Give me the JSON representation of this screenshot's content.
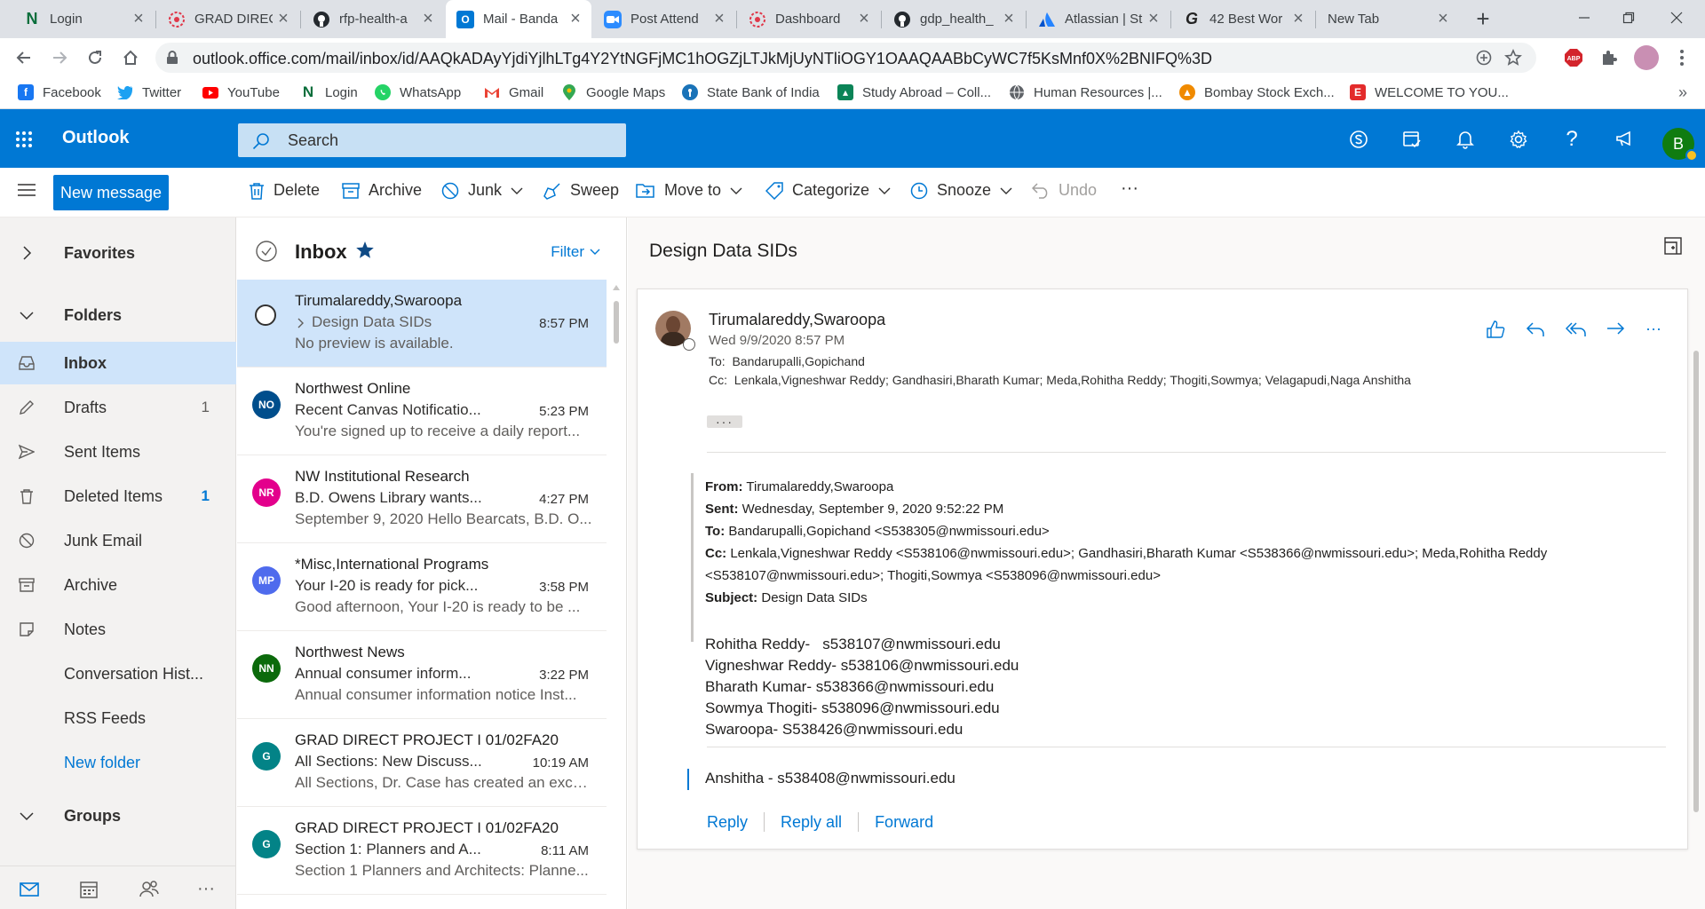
{
  "browser": {
    "tabs": [
      {
        "title": "Login",
        "favicon": "N",
        "color": "#0a6e3b"
      },
      {
        "title": "GRAD DIREC",
        "favicon": "canvas",
        "color": "#e0384a"
      },
      {
        "title": "rfp-health-a",
        "favicon": "github",
        "color": "#24292e"
      },
      {
        "title": "Mail - Banda",
        "favicon": "outlook",
        "color": "#0078d4"
      },
      {
        "title": "Post Attend",
        "favicon": "zoom",
        "color": "#2d8cff"
      },
      {
        "title": "Dashboard",
        "favicon": "canvas",
        "color": "#e0384a"
      },
      {
        "title": "gdp_health_",
        "favicon": "github",
        "color": "#24292e"
      },
      {
        "title": "Atlassian | St",
        "favicon": "atlassian",
        "color": "#0052cc"
      },
      {
        "title": "42 Best Wor",
        "favicon": "G",
        "color": "#222222"
      },
      {
        "title": "New Tab",
        "favicon": "",
        "color": ""
      }
    ],
    "url": "outlook.office.com/mail/inbox/id/AAQkADAyYjdiYjlhLTg4Y2YtNGFjMC1hOGZjLTJkMjUyNTliOGY1OAAQAABbCyWC7f5KsMnf0X%2BNIFQ%3D",
    "bookmarks": [
      {
        "label": "Facebook",
        "icon": "facebook-icon",
        "color": "#1877f2"
      },
      {
        "label": "Twitter",
        "icon": "twitter-icon",
        "color": "#1da1f2"
      },
      {
        "label": "YouTube",
        "icon": "youtube-icon",
        "color": "#ff0000"
      },
      {
        "label": "Login",
        "icon": "n-icon",
        "color": "#0a6e3b"
      },
      {
        "label": "WhatsApp",
        "icon": "whatsapp-icon",
        "color": "#25d366"
      },
      {
        "label": "Gmail",
        "icon": "gmail-icon",
        "color": "#ea4335"
      },
      {
        "label": "Google Maps",
        "icon": "maps-icon",
        "color": "#34a853"
      },
      {
        "label": "State Bank of India",
        "icon": "sbi-icon",
        "color": "#1a73b8"
      },
      {
        "label": "Study Abroad – Coll...",
        "icon": "study-icon",
        "color": "#0b8457"
      },
      {
        "label": "Human Resources |...",
        "icon": "globe-icon",
        "color": "#5f6368"
      },
      {
        "label": "Bombay Stock Exch...",
        "icon": "bse-icon",
        "color": "#f08a00"
      },
      {
        "label": "WELCOME TO YOU...",
        "icon": "e-icon",
        "color": "#e32b2b"
      }
    ],
    "abp_label": "ABP"
  },
  "outlook": {
    "brand": "Outlook",
    "search_placeholder": "Search",
    "user_initial": "B",
    "accent": "#0078d4"
  },
  "toolbar": {
    "new_message": "New message",
    "delete": "Delete",
    "archive": "Archive",
    "junk": "Junk",
    "sweep": "Sweep",
    "move_to": "Move to",
    "categorize": "Categorize",
    "snooze": "Snooze",
    "undo": "Undo",
    "more": "···"
  },
  "nav": {
    "favorites": "Favorites",
    "folders": "Folders",
    "items": [
      {
        "label": "Inbox",
        "count": ""
      },
      {
        "label": "Drafts",
        "count": "1"
      },
      {
        "label": "Sent Items",
        "count": ""
      },
      {
        "label": "Deleted Items",
        "count": "1"
      },
      {
        "label": "Junk Email",
        "count": ""
      },
      {
        "label": "Archive",
        "count": ""
      },
      {
        "label": "Notes",
        "count": ""
      },
      {
        "label": "Conversation Hist...",
        "count": ""
      },
      {
        "label": "RSS Feeds",
        "count": ""
      }
    ],
    "new_folder": "New folder",
    "groups": "Groups"
  },
  "list": {
    "title": "Inbox",
    "filter": "Filter",
    "messages": [
      {
        "sender": "Tirumalareddy,Swaroopa",
        "subject": "Design Data SIDs",
        "time": "8:57 PM",
        "preview": "No preview is available.",
        "initials": "",
        "color": ""
      },
      {
        "sender": "Northwest Online",
        "subject": "Recent Canvas Notificatio...",
        "time": "5:23 PM",
        "preview": "You're signed up to receive a daily report...",
        "initials": "NO",
        "color": "#004e8c"
      },
      {
        "sender": "NW Institutional Research",
        "subject": "B.D. Owens Library wants...",
        "time": "4:27 PM",
        "preview": "September 9, 2020 Hello Bearcats, B.D. O...",
        "initials": "NR",
        "color": "#e3008c"
      },
      {
        "sender": "*Misc,International Programs",
        "subject": "Your I-20 is ready for pick...",
        "time": "3:58 PM",
        "preview": "Good afternoon, Your I-20 is ready to be ...",
        "initials": "MP",
        "color": "#4f6bed"
      },
      {
        "sender": "Northwest News",
        "subject": "Annual consumer inform...",
        "time": "3:22 PM",
        "preview": "Annual consumer information notice Inst...",
        "initials": "NN",
        "color": "#0b6a0b"
      },
      {
        "sender": "GRAD DIRECT PROJECT I 01/02FA20",
        "subject": "All Sections: New Discuss...",
        "time": "10:19 AM",
        "preview": "All Sections, Dr. Case has created an exce...",
        "initials": "G",
        "color": "#038387"
      },
      {
        "sender": "GRAD DIRECT PROJECT I 01/02FA20",
        "subject": "Section 1: Planners and A...",
        "time": "8:11 AM",
        "preview": "Section 1 Planners and Architects: Planne...",
        "initials": "G",
        "color": "#038387"
      }
    ]
  },
  "reading": {
    "subject": "Design Data SIDs",
    "from": "Tirumalareddy,Swaroopa",
    "date": "Wed 9/9/2020 8:57 PM",
    "to_label": "To:",
    "to": "Bandarupalli,Gopichand",
    "cc_label": "Cc:",
    "cc": "Lenkala,Vigneshwar Reddy; Gandhasiri,Bharath Kumar; Meda,Rohitha Reddy; Thogiti,Sowmya; Velagapudi,Naga Anshitha",
    "more": "···",
    "fwd": {
      "from_label": "From:",
      "from": "Tirumalareddy,Swaroopa",
      "sent_label": "Sent:",
      "sent": "Wednesday, September 9, 2020 9:52:22 PM",
      "to_label": "To:",
      "to": "Bandarupalli,Gopichand <S538305@nwmissouri.edu>",
      "cc_label": "Cc:",
      "cc1": "Lenkala,Vigneshwar Reddy <S538106@nwmissouri.edu>; Gandhasiri,Bharath Kumar <S538366@nwmissouri.edu>; Meda,Rohitha Reddy",
      "cc2": "<S538107@nwmissouri.edu>; Thogiti,Sowmya <S538096@nwmissouri.edu>",
      "subject_label": "Subject:",
      "subject": "Design Data SIDs"
    },
    "body_lines": [
      "Rohitha Reddy-   s538107@nwmissouri.edu",
      "Vigneshwar Reddy- s538106@nwmissouri.edu",
      "Bharath Kumar- s538366@nwmissouri.edu",
      "Sowmya Thogiti- s538096@nwmissouri.edu",
      "Swaroopa- S538426@nwmissouri.edu"
    ],
    "extra_line": "Anshitha - s538408@nwmissouri.edu",
    "reply": "Reply",
    "reply_all": "Reply all",
    "forward": "Forward"
  }
}
